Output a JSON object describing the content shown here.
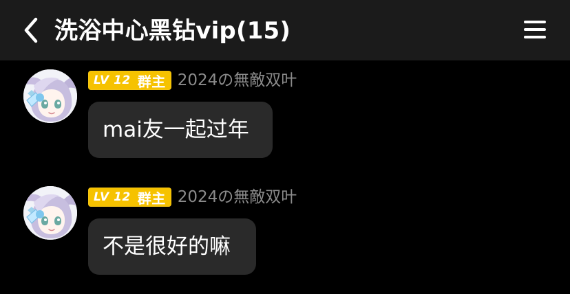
{
  "header": {
    "back_icon": "chevron-left-icon",
    "title": "洗浴中心黑钻vip(15)",
    "menu_icon": "hamburger-menu-icon"
  },
  "messages": [
    {
      "avatar_icon": "anime-avatar-icon",
      "level": "LV 12",
      "role": "群主",
      "sender": "2024の無敵双叶",
      "text": "mai友一起过年"
    },
    {
      "avatar_icon": "anime-avatar-icon",
      "level": "LV 12",
      "role": "群主",
      "sender": "2024の無敵双叶",
      "text": "不是很好的嘛"
    }
  ],
  "colors": {
    "header_background": "#1b1b1b",
    "page_background": "#000000",
    "bubble_background": "#2a2a2a",
    "badge_background": "#f6c200",
    "sender_text": "#8b8b8b"
  }
}
